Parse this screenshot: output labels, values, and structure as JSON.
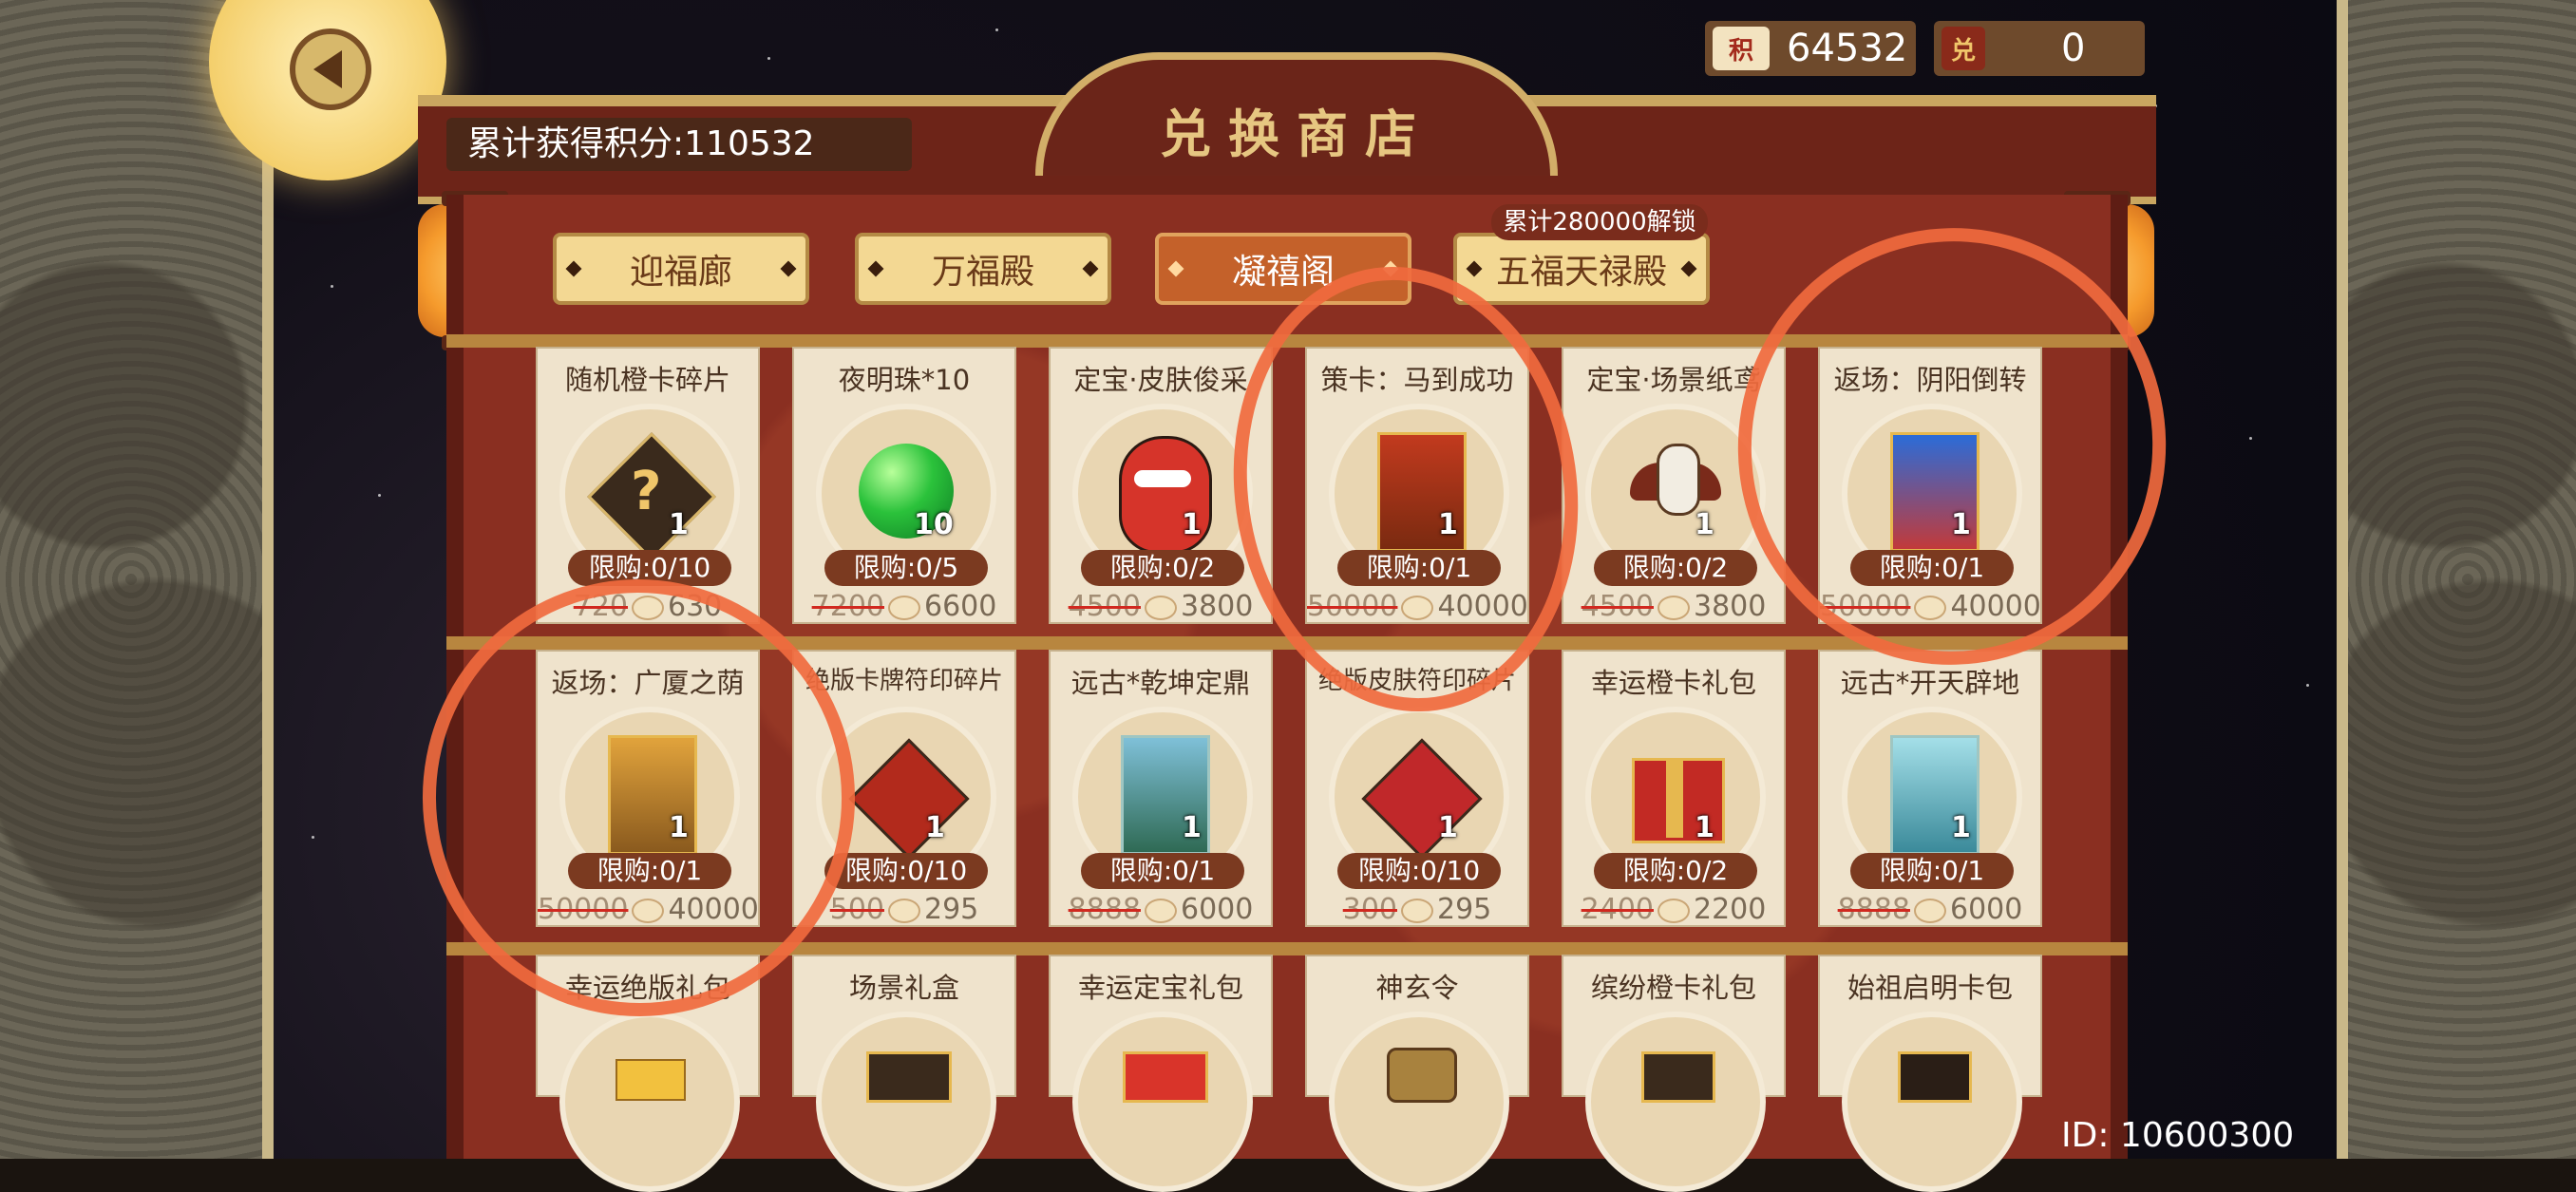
{
  "currencies": {
    "points": "64532",
    "exchange": "0",
    "points_icon_text": "积",
    "exchange_icon_text": "兑"
  },
  "header": {
    "title": "兑换商店",
    "total_points": "累计获得积分:110532"
  },
  "tabs": [
    {
      "label": "迎福廊",
      "active": false
    },
    {
      "label": "万福殿",
      "active": false
    },
    {
      "label": "凝禧阁",
      "active": true
    },
    {
      "label": "五福天禄殿",
      "active": false,
      "badge": "累计280000解锁"
    }
  ],
  "items": [
    {
      "name": "随机橙卡碎片",
      "qty": "1",
      "limit": "限购:0/10",
      "old_price": "720",
      "price": "630",
      "icon": "question-shard-icon"
    },
    {
      "name": "夜明珠*10",
      "qty": "10",
      "limit": "限购:0/5",
      "old_price": "7200",
      "price": "6600",
      "icon": "pearl-icon"
    },
    {
      "name": "定宝·皮肤俊采",
      "qty": "1",
      "limit": "限购:0/2",
      "old_price": "4500",
      "price": "3800",
      "icon": "opera-mask-icon"
    },
    {
      "name": "策卡：马到成功",
      "qty": "1",
      "limit": "限购:0/1",
      "old_price": "50000",
      "price": "40000",
      "icon": "horse-card-icon"
    },
    {
      "name": "定宝·场景纸鸢",
      "qty": "1",
      "limit": "限购:0/2",
      "old_price": "4500",
      "price": "3800",
      "icon": "kite-icon"
    },
    {
      "name": "返场：阴阳倒转",
      "qty": "1",
      "limit": "限购:0/1",
      "old_price": "50000",
      "price": "40000",
      "icon": "yinyang-card-icon"
    },
    {
      "name": "返场：广厦之荫",
      "qty": "1",
      "limit": "限购:0/1",
      "old_price": "50000",
      "price": "40000",
      "icon": "pavilion-card-icon"
    },
    {
      "name": "绝版卡牌符印碎片",
      "qty": "1",
      "limit": "限购:0/10",
      "old_price": "500",
      "price": "295",
      "icon": "card-seal-icon"
    },
    {
      "name": "远古*乾坤定鼎",
      "qty": "1",
      "limit": "限购:0/1",
      "old_price": "8888",
      "price": "6000",
      "icon": "landscape-card-icon"
    },
    {
      "name": "绝版皮肤符印碎片",
      "qty": "1",
      "limit": "限购:0/10",
      "old_price": "300",
      "price": "295",
      "icon": "skin-seal-icon"
    },
    {
      "name": "幸运橙卡礼包",
      "qty": "1",
      "limit": "限购:0/2",
      "old_price": "2400",
      "price": "2200",
      "icon": "gift-box-icon"
    },
    {
      "name": "远古*开天辟地",
      "qty": "1",
      "limit": "限购:0/1",
      "old_price": "8888",
      "price": "6000",
      "icon": "landscape-card-icon"
    },
    {
      "name": "幸运绝版礼包",
      "icon": "gold-bundle-icon"
    },
    {
      "name": "场景礼盒",
      "icon": "gift-chest-icon"
    },
    {
      "name": "幸运定宝礼包",
      "icon": "ribbon-gift-icon"
    },
    {
      "name": "神玄令",
      "icon": "token-icon"
    },
    {
      "name": "缤纷橙卡礼包",
      "icon": "card-pack-icon"
    },
    {
      "name": "始祖启明卡包",
      "icon": "card-pack-icon"
    }
  ],
  "footer": {
    "id": "ID: 10600300"
  }
}
